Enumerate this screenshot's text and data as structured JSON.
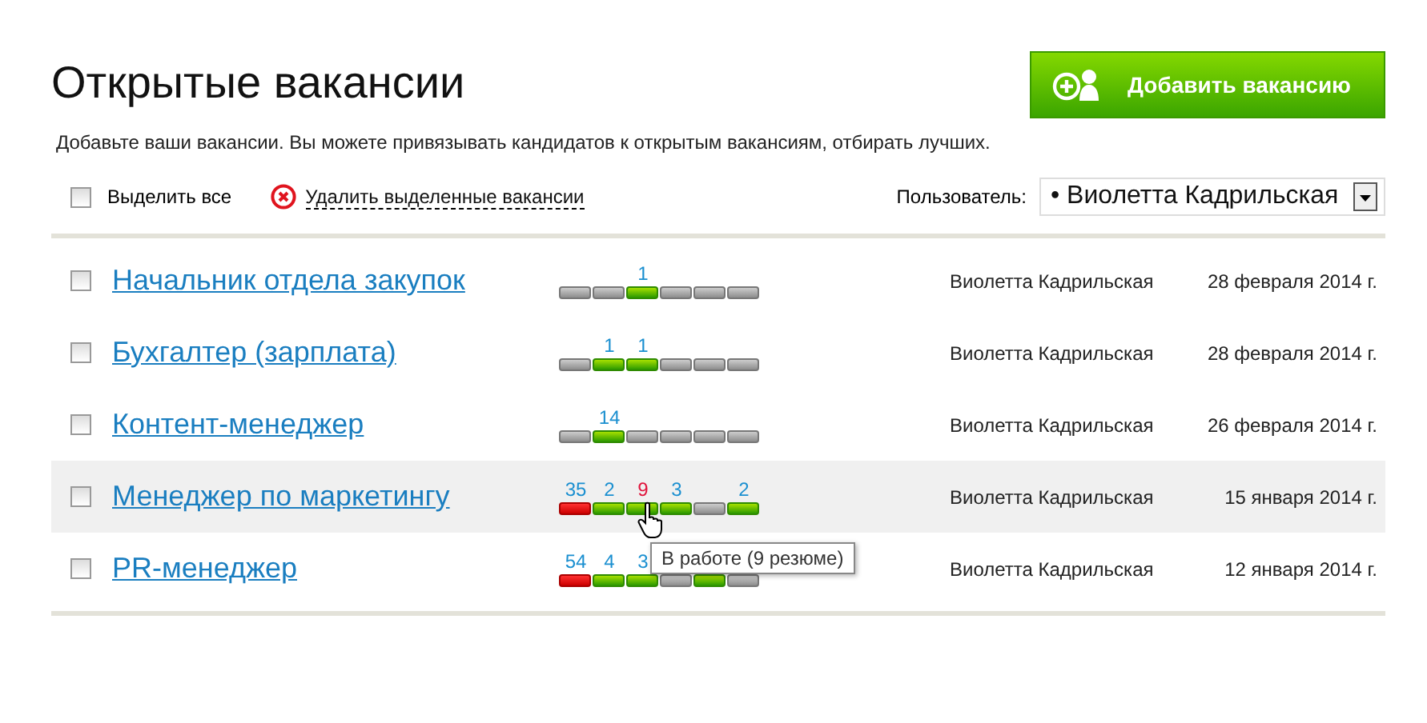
{
  "title": "Открытые вакансии",
  "add_button": {
    "label": "Добавить вакансию"
  },
  "hint": "Добавьте ваши вакансии. Вы можете привязывать кандидатов к открытым вакансиям, отбирать лучших.",
  "toolbar": {
    "select_all": {
      "label": "Выделить все",
      "checked": false
    },
    "delete_link": "Удалить выделенные вакансии",
    "user_label": "Пользователь:",
    "user_value": "• Виолетта Кадрильская"
  },
  "vacancies": [
    {
      "title": "Начальник отдела закупок",
      "checked": false,
      "hovered": false,
      "owner": "Виолетта Кадрильская",
      "date": "28 февраля 2014 г.",
      "stages": [
        {
          "kind": "empty"
        },
        {
          "kind": "empty"
        },
        {
          "kind": "active",
          "count": "1"
        },
        {
          "kind": "empty"
        },
        {
          "kind": "empty"
        },
        {
          "kind": "empty"
        }
      ]
    },
    {
      "title": "Бухгалтер (зарплата)",
      "checked": false,
      "hovered": false,
      "owner": "Виолетта Кадрильская",
      "date": "28 февраля 2014 г.",
      "stages": [
        {
          "kind": "empty"
        },
        {
          "kind": "active",
          "count": "1"
        },
        {
          "kind": "active",
          "count": "1"
        },
        {
          "kind": "empty"
        },
        {
          "kind": "empty"
        },
        {
          "kind": "empty"
        }
      ]
    },
    {
      "title": "Контент-менеджер",
      "checked": false,
      "hovered": false,
      "owner": "Виолетта Кадрильская",
      "date": "26 февраля 2014 г.",
      "stages": [
        {
          "kind": "empty"
        },
        {
          "kind": "active",
          "count": "14"
        },
        {
          "kind": "empty"
        },
        {
          "kind": "empty"
        },
        {
          "kind": "empty"
        },
        {
          "kind": "empty"
        }
      ]
    },
    {
      "title": "Менеджер по маркетингу",
      "checked": false,
      "hovered": true,
      "owner": "Виолетта Кадрильская",
      "date": "15 января 2014 г.",
      "stages": [
        {
          "kind": "rejected",
          "count": "35"
        },
        {
          "kind": "active",
          "count": "2"
        },
        {
          "kind": "active",
          "count": "9",
          "tooltip": "В работе (9 резюме)"
        },
        {
          "kind": "active",
          "count": "3"
        },
        {
          "kind": "empty"
        },
        {
          "kind": "active",
          "count": "2"
        }
      ]
    },
    {
      "title": "PR-менеджер",
      "checked": false,
      "hovered": false,
      "owner": "Виолетта Кадрильская",
      "date": "12 января 2014 г.",
      "stages": [
        {
          "kind": "rejected",
          "count": "54"
        },
        {
          "kind": "active",
          "count": "4"
        },
        {
          "kind": "active",
          "count": "3"
        },
        {
          "kind": "empty"
        },
        {
          "kind": "active"
        },
        {
          "kind": "empty"
        }
      ]
    }
  ]
}
